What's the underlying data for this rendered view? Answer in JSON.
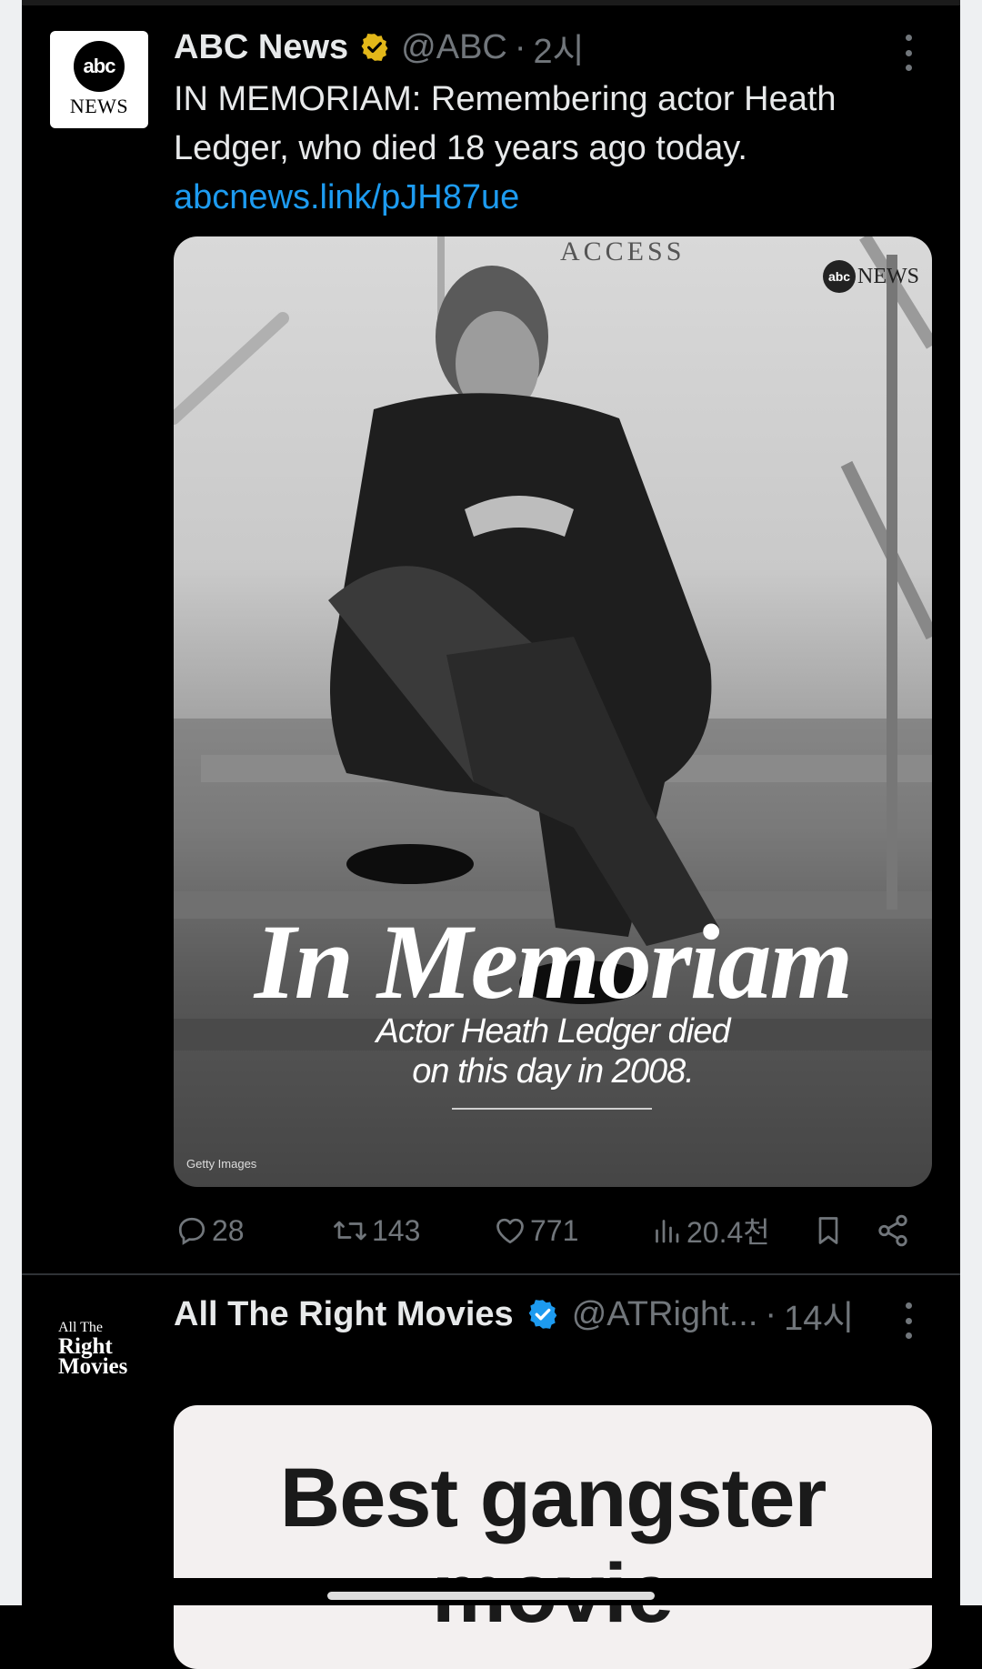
{
  "tweet1": {
    "avatar": {
      "top": "abc",
      "bottom": "NEWS"
    },
    "name": "ABC News",
    "handle": "@ABC",
    "dot": "·",
    "time": "2시",
    "text": "IN MEMORIAM: Remembering actor Heath Ledger, who died 18 years ago today.",
    "link": "abcnews.link/pJH87ue",
    "media": {
      "sign": "ACCESS",
      "watermark_circle": "abc",
      "watermark_word": "NEWS",
      "title": "In Memoriam",
      "subtitle_line1": "Actor Heath Ledger died",
      "subtitle_line2": "on this day in 2008.",
      "credit": "Getty Images"
    },
    "actions": {
      "replies": "28",
      "reposts": "143",
      "likes": "771",
      "views": "20.4천"
    },
    "colors": {
      "badge": "#e2b719",
      "link": "#1d9bf0"
    }
  },
  "tweet2": {
    "avatar": {
      "line1": "All The",
      "line2": "Right",
      "line3": "Movies"
    },
    "name": "All The Right Movies",
    "handle": "@ATRight...",
    "dot": "·",
    "time": "14시",
    "media": {
      "line1": "Best gangster",
      "line2": "movie"
    },
    "colors": {
      "badge": "#1d9bf0"
    }
  }
}
